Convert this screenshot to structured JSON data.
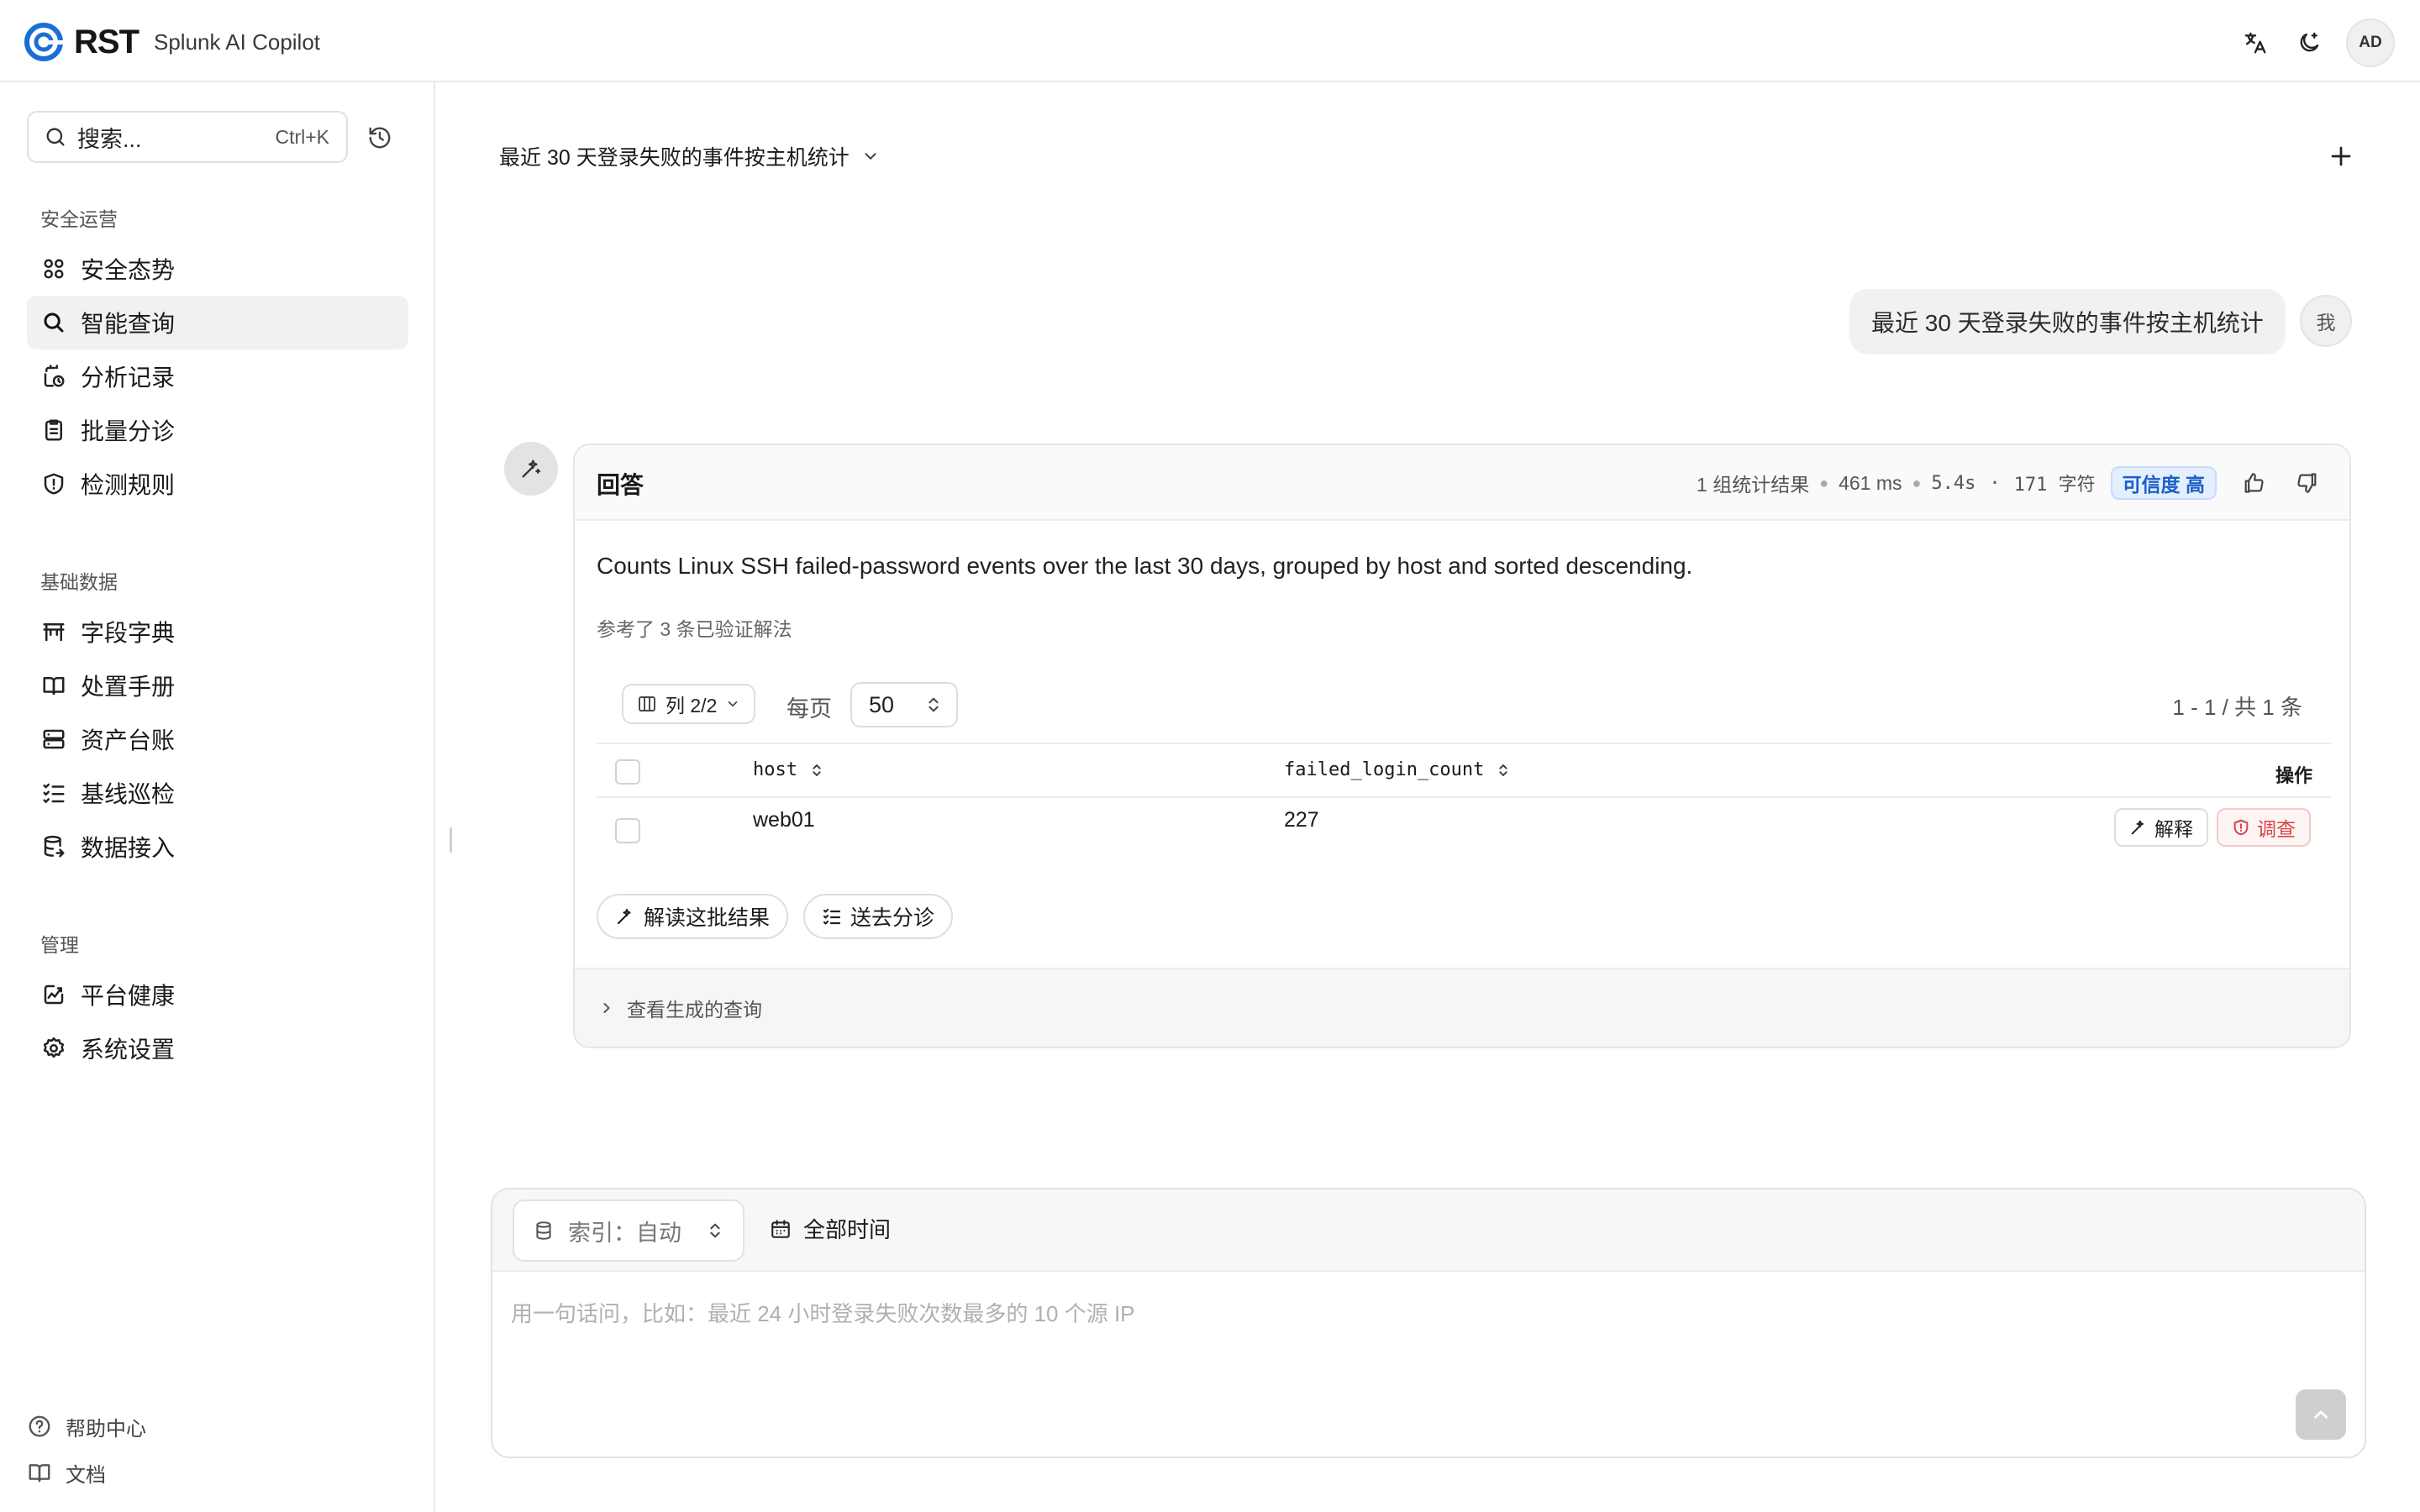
{
  "header": {
    "logo_text": "RST",
    "app_name": "Splunk AI Copilot",
    "avatar_initials": "AD"
  },
  "sidebar": {
    "search_placeholder": "搜索...",
    "search_shortcut": "Ctrl+K",
    "sections": [
      {
        "label": "安全运营",
        "items": [
          {
            "label": "安全态势",
            "icon": "dashboard-grid-icon"
          },
          {
            "label": "智能查询",
            "icon": "search-icon",
            "active": true
          },
          {
            "label": "分析记录",
            "icon": "clock-history-icon"
          },
          {
            "label": "批量分诊",
            "icon": "clipboard-list-icon"
          },
          {
            "label": "检测规则",
            "icon": "shield-alert-icon"
          }
        ]
      },
      {
        "label": "基础数据",
        "items": [
          {
            "label": "字段字典",
            "icon": "table-header-icon"
          },
          {
            "label": "处置手册",
            "icon": "book-icon"
          },
          {
            "label": "资产台账",
            "icon": "server-icon"
          },
          {
            "label": "基线巡检",
            "icon": "list-check-icon"
          },
          {
            "label": "数据接入",
            "icon": "database-import-icon"
          }
        ]
      },
      {
        "label": "管理",
        "items": [
          {
            "label": "平台健康",
            "icon": "activity-chart-icon"
          },
          {
            "label": "系统设置",
            "icon": "gear-icon"
          }
        ]
      }
    ],
    "footer": [
      {
        "label": "帮助中心",
        "icon": "help-circle-icon"
      },
      {
        "label": "文档",
        "icon": "book-open-icon"
      }
    ]
  },
  "conversation": {
    "title": "最近 30 天登录失败的事件按主机统计",
    "user_message": "最近 30 天登录失败的事件按主机统计",
    "user_avatar": "我"
  },
  "answer": {
    "title": "回答",
    "meta": {
      "groups": "1 组统计结果",
      "latency": "461 ms",
      "duration": "5.4s",
      "chars_sep": "·",
      "chars": "171 字符",
      "confidence": "可信度 高"
    },
    "text": "Counts Linux SSH failed-password events over the last 30 days, grouped by host and sorted descending.",
    "reference": "参考了 3 条已验证解法",
    "columns_button": "列 2/2",
    "per_page_label": "每页",
    "per_page_value": "50",
    "pager_info": "1 - 1 / 共 1 条",
    "table": {
      "headers": [
        "host",
        "failed_login_count",
        "操作"
      ],
      "rows": [
        {
          "host": "web01",
          "failed_login_count": "227",
          "explain_label": "解释",
          "investigate_label": "调查"
        }
      ]
    },
    "actions": {
      "interpret": "解读这批结果",
      "triage": "送去分诊"
    },
    "query_toggle": "查看生成的查询"
  },
  "composer": {
    "index_label": "索引：自动",
    "time_label": "全部时间",
    "placeholder": "用一句话问，比如：最近 24 小时登录失败次数最多的 10 个源 IP"
  },
  "colors": {
    "brand_blue": "#1a6fd6",
    "confidence_badge_bg": "#e3efff",
    "investigate_red": "#d64545"
  }
}
